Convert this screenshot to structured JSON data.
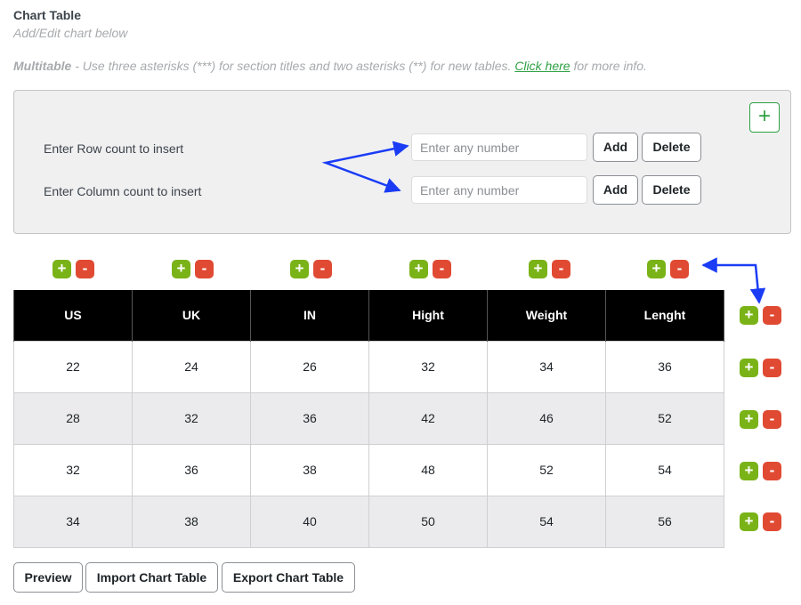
{
  "header": {
    "title": "Chart Table",
    "subtitle": "Add/Edit chart below",
    "multitable_bold": "Multitable",
    "multitable_text": " - Use three asterisks (***) for section titles and two asterisks (**) for new tables. ",
    "link_text": "Click here",
    "multitable_suffix": " for more info."
  },
  "insert_panel": {
    "add_icon": "+",
    "row_label": "Enter Row count to insert",
    "column_label": "Enter Column count to insert",
    "row_input": {
      "value": "",
      "placeholder": "Enter any number"
    },
    "column_input": {
      "value": "",
      "placeholder": "Enter any number"
    },
    "add_label": "Add",
    "delete_label": "Delete"
  },
  "controls": {
    "plus": "+",
    "minus": "-"
  },
  "table": {
    "columns": [
      "US",
      "UK",
      "IN",
      "Hight",
      "Weight",
      "Lenght"
    ],
    "rows": [
      [
        "22",
        "24",
        "26",
        "32",
        "34",
        "36"
      ],
      [
        "28",
        "32",
        "36",
        "42",
        "46",
        "52"
      ],
      [
        "32",
        "36",
        "38",
        "48",
        "52",
        "54"
      ],
      [
        "34",
        "38",
        "40",
        "50",
        "54",
        "56"
      ]
    ]
  },
  "footer": {
    "preview_label": "Preview",
    "import_label": "Import Chart Table",
    "export_label": "Export Chart Table"
  },
  "colors": {
    "plus_green": "#7ab317",
    "minus_red": "#e04a33",
    "header_black": "#000000",
    "annotation_blue": "#1a3cf5",
    "link_green": "#2ea043"
  },
  "icons": {
    "panel_add": "plus-icon",
    "column_add": "plus-icon",
    "column_remove": "minus-icon",
    "row_add": "plus-icon",
    "row_remove": "minus-icon",
    "annotation": "arrow-icon"
  }
}
